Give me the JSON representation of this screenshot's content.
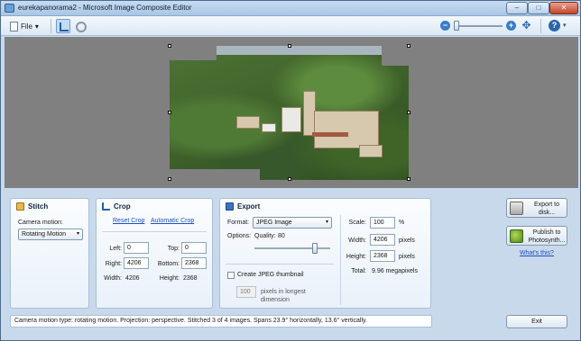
{
  "window": {
    "title": "eurekapanorama2 - Microsoft Image Composite Editor",
    "min": "–",
    "max": "□",
    "close": "✕"
  },
  "toolbar": {
    "file_label": "File",
    "file_caret": "▾",
    "zoom_out": "−",
    "zoom_in": "+",
    "fit": "✥",
    "help": "?",
    "help_caret": "▾"
  },
  "stitch": {
    "title": "Stitch",
    "camera_motion_label": "Camera motion:",
    "camera_motion_value": "Rotating Motion",
    "caret": "▾"
  },
  "crop": {
    "title": "Crop",
    "reset": "Reset Crop",
    "automatic": "Automatic Crop",
    "left_label": "Left:",
    "left": "0",
    "top_label": "Top:",
    "top": "0",
    "right_label": "Right:",
    "right": "4206",
    "bottom_label": "Bottom:",
    "bottom": "2368",
    "width_label": "Width:",
    "width": "4206",
    "height_label": "Height:",
    "height": "2368"
  },
  "export": {
    "title": "Export",
    "format_label": "Format:",
    "format_value": "JPEG Image",
    "caret": "▾",
    "options_label": "Options:",
    "quality_label": "Quality:",
    "quality_value": "80",
    "quality_level": 0.8,
    "thumbnail_label": "Create JPEG thumbnail",
    "thumb_size": "100",
    "thumb_unit_line1": "pixels in longest",
    "thumb_unit_line2": "dimension",
    "scale_label": "Scale:",
    "scale_value": "100",
    "scale_unit": "%",
    "width_label": "Width:",
    "width_value": "4206",
    "width_unit": "pixels",
    "height_label": "Height:",
    "height_value": "2368",
    "height_unit": "pixels",
    "total_label": "Total:",
    "total_value": "9.96 megapixels"
  },
  "actions": {
    "export_disk_line1": "Export to",
    "export_disk_line2": "disk...",
    "publish_line1": "Publish to",
    "publish_line2": "Photosynth...",
    "whats_this": "What's this?",
    "exit": "Exit"
  },
  "status": "Camera motion type: rotating motion. Projection: perspective. Stitched 3 of 4 images. Spans 23.9° horizontally, 13.6° vertically.",
  "colors": {
    "canvas_bg": "#808080",
    "link": "#1b4fbf",
    "chrome": "#c9d9ec"
  }
}
